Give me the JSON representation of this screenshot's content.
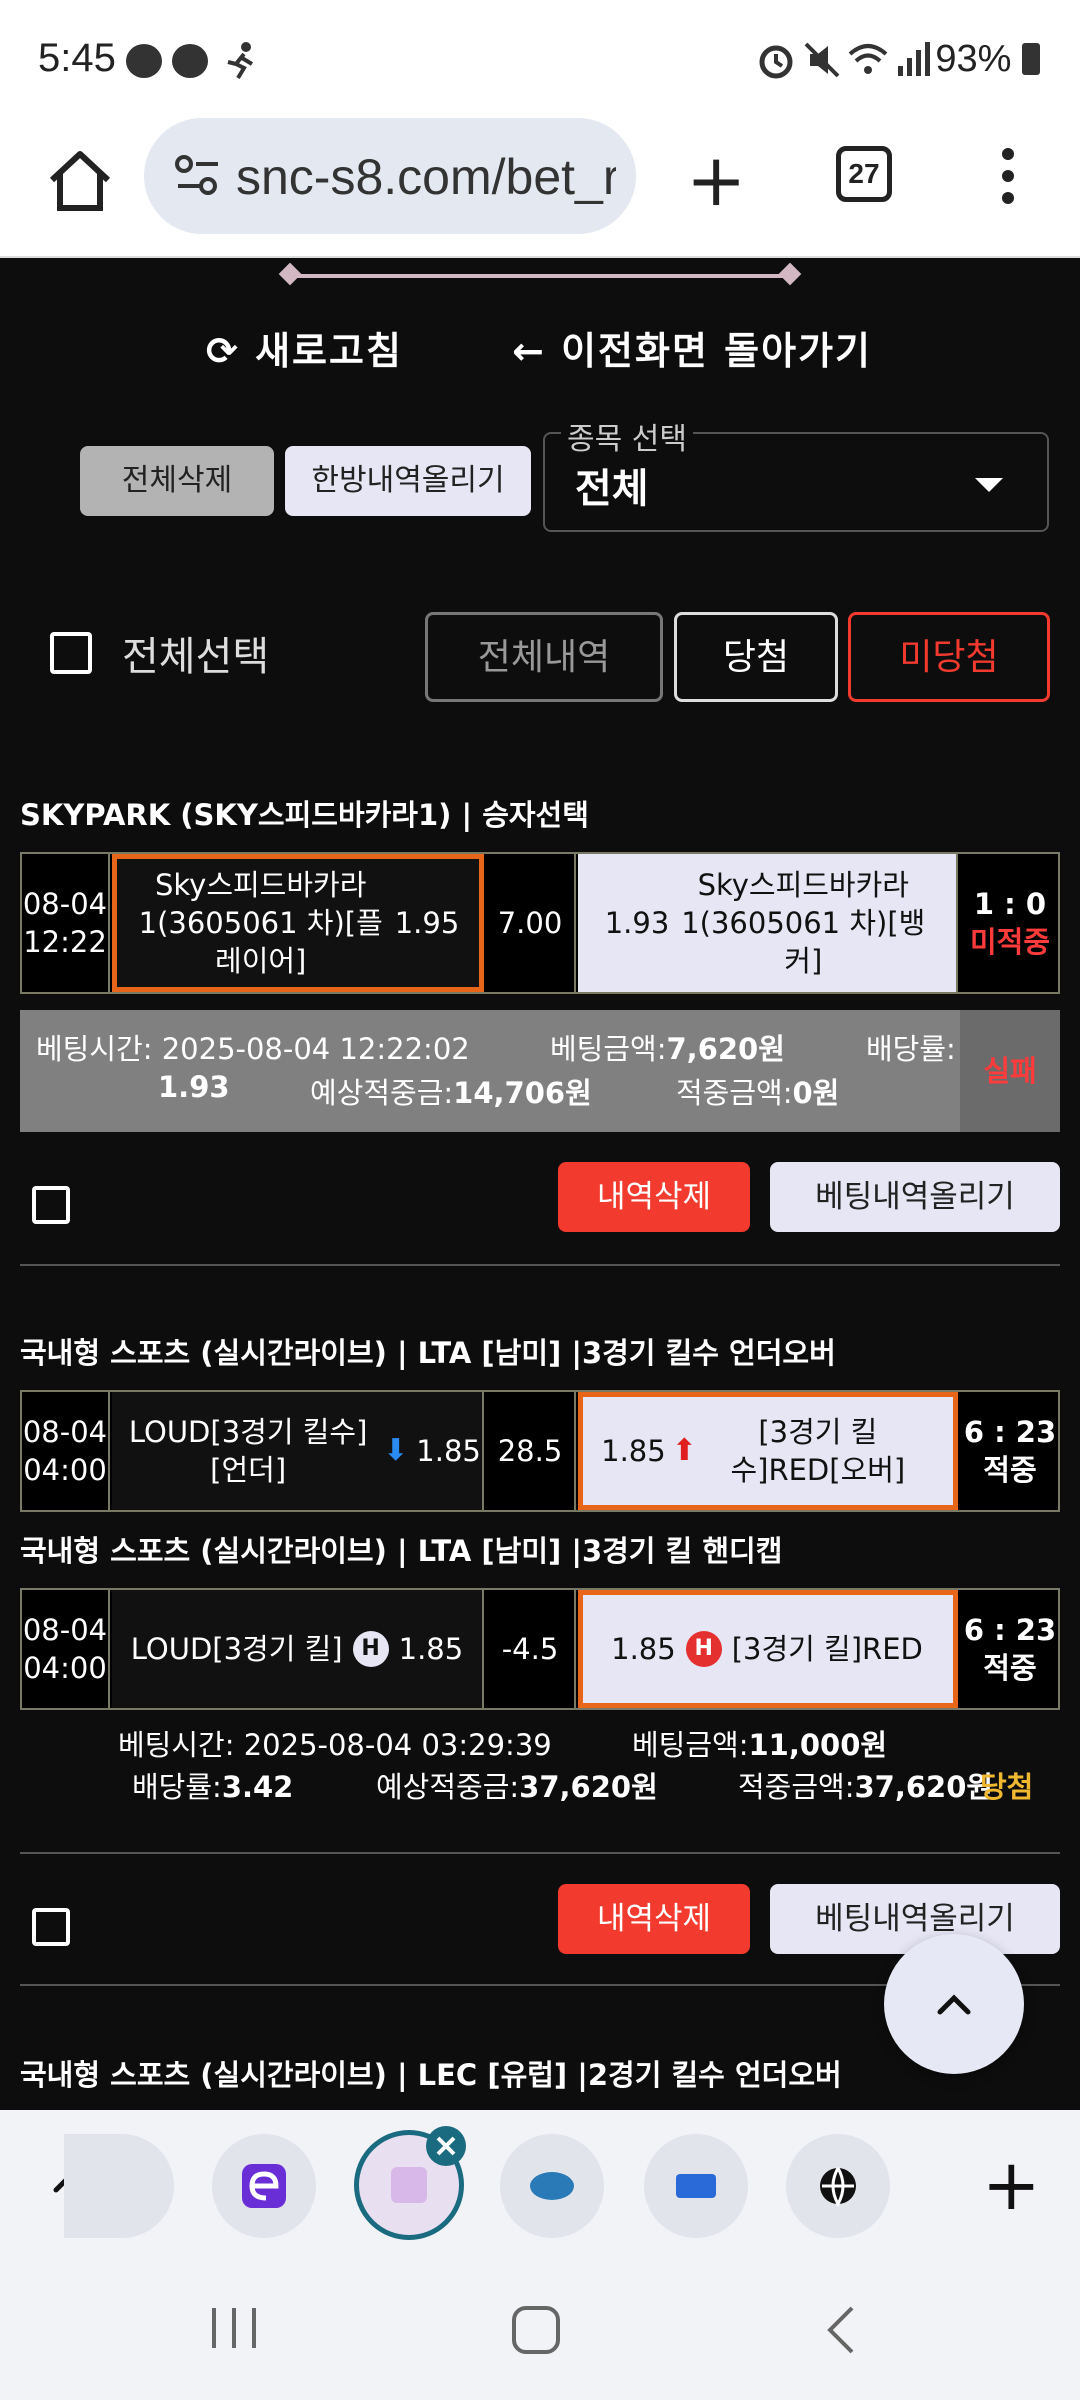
{
  "status_bar": {
    "time": "5:45",
    "battery": "93%"
  },
  "browser": {
    "url": "snc-s8.com/bet_r",
    "tab_count": "27"
  },
  "top_links": {
    "refresh": "새로고침",
    "back": "이전화면 돌아가기"
  },
  "controls": {
    "delete_all": "전체삭제",
    "upload_all": "한방내역올리기",
    "select_label": "종목 선택",
    "select_value": "전체",
    "select_all": "전체선택",
    "filter_all": "전체내역",
    "filter_win": "당첨",
    "filter_lose": "미당첨"
  },
  "bets": [
    {
      "title": "SKYPARK (SKY스피드바카라1) | 승자선택",
      "games": [
        {
          "date": "08-04",
          "time": "12:22",
          "home": "Sky스피드바카라1(3605061 차)[플레이어]",
          "home_odds": "1.95",
          "mid": "7.00",
          "away_odds": "1.93",
          "away": "Sky스피드바카라1(3605061 차)[뱅커]",
          "score": "1 : 0",
          "result": "미적중"
        }
      ],
      "info": {
        "time_label": "베팅시간:",
        "time": "2025-08-04 12:22:02",
        "amount_label": "베팅금액:",
        "amount": "7,620원",
        "odds_label": "배당률:",
        "odds": "1.93",
        "expected_label": "예상적중금:",
        "expected": "14,706원",
        "won_label": "적중금액:",
        "won": "0원",
        "status": "실패"
      },
      "delete_label": "내역삭제",
      "upload_label": "베팅내역올리기"
    },
    {
      "games": [
        {
          "title": "국내형 스포츠 (실시간라이브) | LTA [남미]  |3경기 킬수 언더오버",
          "date": "08-04",
          "time": "04:00",
          "home": "LOUD[3경기 킬수][언더]",
          "home_odds": "1.85",
          "mid": "28.5",
          "away_odds": "1.85",
          "away": "[3경기 킬수]RED[오버]",
          "score": "6 : 23",
          "result": "적중"
        },
        {
          "title": "국내형 스포츠 (실시간라이브) | LTA [남미]  |3경기 킬 핸디캡",
          "date": "08-04",
          "time": "04:00",
          "home": "LOUD[3경기 킬]",
          "home_odds": "1.85",
          "mid": "-4.5",
          "away_odds": "1.85",
          "away": "[3경기 킬]RED",
          "score": "6 : 23",
          "result": "적중"
        }
      ],
      "info": {
        "time_label": "베팅시간:",
        "time": "2025-08-04 03:29:39",
        "amount_label": "베팅금액:",
        "amount": "11,000원",
        "odds_label": "배당률:",
        "odds": "3.42",
        "expected_label": "예상적중금:",
        "expected": "37,620원",
        "won_label": "적중금액:",
        "won": "37,620원",
        "status": "당첨"
      },
      "delete_label": "내역삭제",
      "upload_label": "베팅내역올리기"
    }
  ],
  "next_title": "국내형 스포츠 (실시간라이브) | LEC [유럽]  |2경기 킬수 언더오버",
  "colors": {
    "accent_red": "#f23a2e",
    "win_yellow": "#f0b830",
    "select_orange": "#e8661a",
    "lose_red": "#ff3b3b"
  }
}
